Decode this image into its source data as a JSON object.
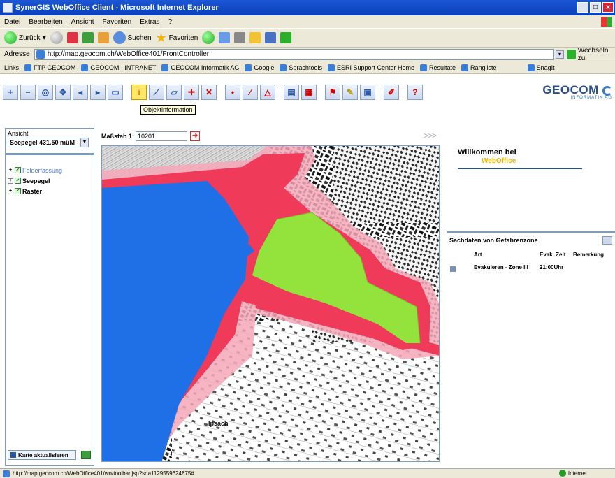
{
  "window": {
    "title": "SynerGIS WebOffice Client - Microsoft Internet Explorer",
    "controls": [
      "_",
      "□",
      "x"
    ]
  },
  "menu": [
    "Datei",
    "Bearbeiten",
    "Ansicht",
    "Favoriten",
    "Extras",
    "?"
  ],
  "toolbar": {
    "back": "Zurück",
    "search": "Suchen",
    "favorites": "Favoriten"
  },
  "address": {
    "label": "Adresse",
    "url": "http://map.geocom.ch/WebOffice401/FrontController",
    "go": "Wechseln zu"
  },
  "links": {
    "label": "Links",
    "items": [
      "FTP GEOCOM",
      "GEOCOM - INTRANET",
      "GEOCOM Informatik AG",
      "Google",
      "Sprachtools",
      "ESRI Support Center Home",
      "Resultate",
      "Rangliste",
      "SnagIt"
    ]
  },
  "app": {
    "tooltip": "Objektinformation",
    "logo": "GEOCOM",
    "logo_sub": "INFORMATIK AG",
    "tools": [
      "zoom-in",
      "zoom-out",
      "zoom-full",
      "pan",
      "zoom-prev",
      "zoom-next",
      "select",
      "identify",
      "measure",
      "measure-area",
      "coordinates",
      "clear",
      "draw-point",
      "draw-line",
      "draw-polygon",
      "print",
      "export",
      "query",
      "report",
      "table",
      "edit",
      "help"
    ]
  },
  "left": {
    "ansicht_label": "Ansicht",
    "ansicht_value": "Seepegel 431.50 müM",
    "layers": [
      {
        "name": "Felderfassung",
        "active": true
      },
      {
        "name": "Seepegel",
        "active": false
      },
      {
        "name": "Raster",
        "active": false
      }
    ],
    "refresh": "Karte aktualisieren"
  },
  "map": {
    "scale_label": "Maßstab 1:",
    "scale_value": "10201",
    "expand": ">>>",
    "place_label": "Ipsach"
  },
  "right": {
    "welcome": "Willkommen bei",
    "welcome_sub": "WebOffice",
    "sach_title": "Sachdaten von Gefahrenzone",
    "columns": [
      "Art",
      "Evak. Zeit",
      "Bemerkung"
    ],
    "rows": [
      {
        "art": "Evakuieren - Zone III",
        "zeit": "21:00Uhr",
        "bemerkung": ""
      }
    ]
  },
  "status": {
    "url": "http://map.geocom.ch/WebOffice401/wo/toolbar.jsp?sna1129559624875#",
    "zone": "Internet"
  },
  "colors": {
    "lake": "#1f6fe6",
    "zone_red": "#ef3a5a",
    "zone_pink": "#f6a7b9",
    "zone_green": "#94e33c",
    "accent": "#2b4e8f"
  }
}
